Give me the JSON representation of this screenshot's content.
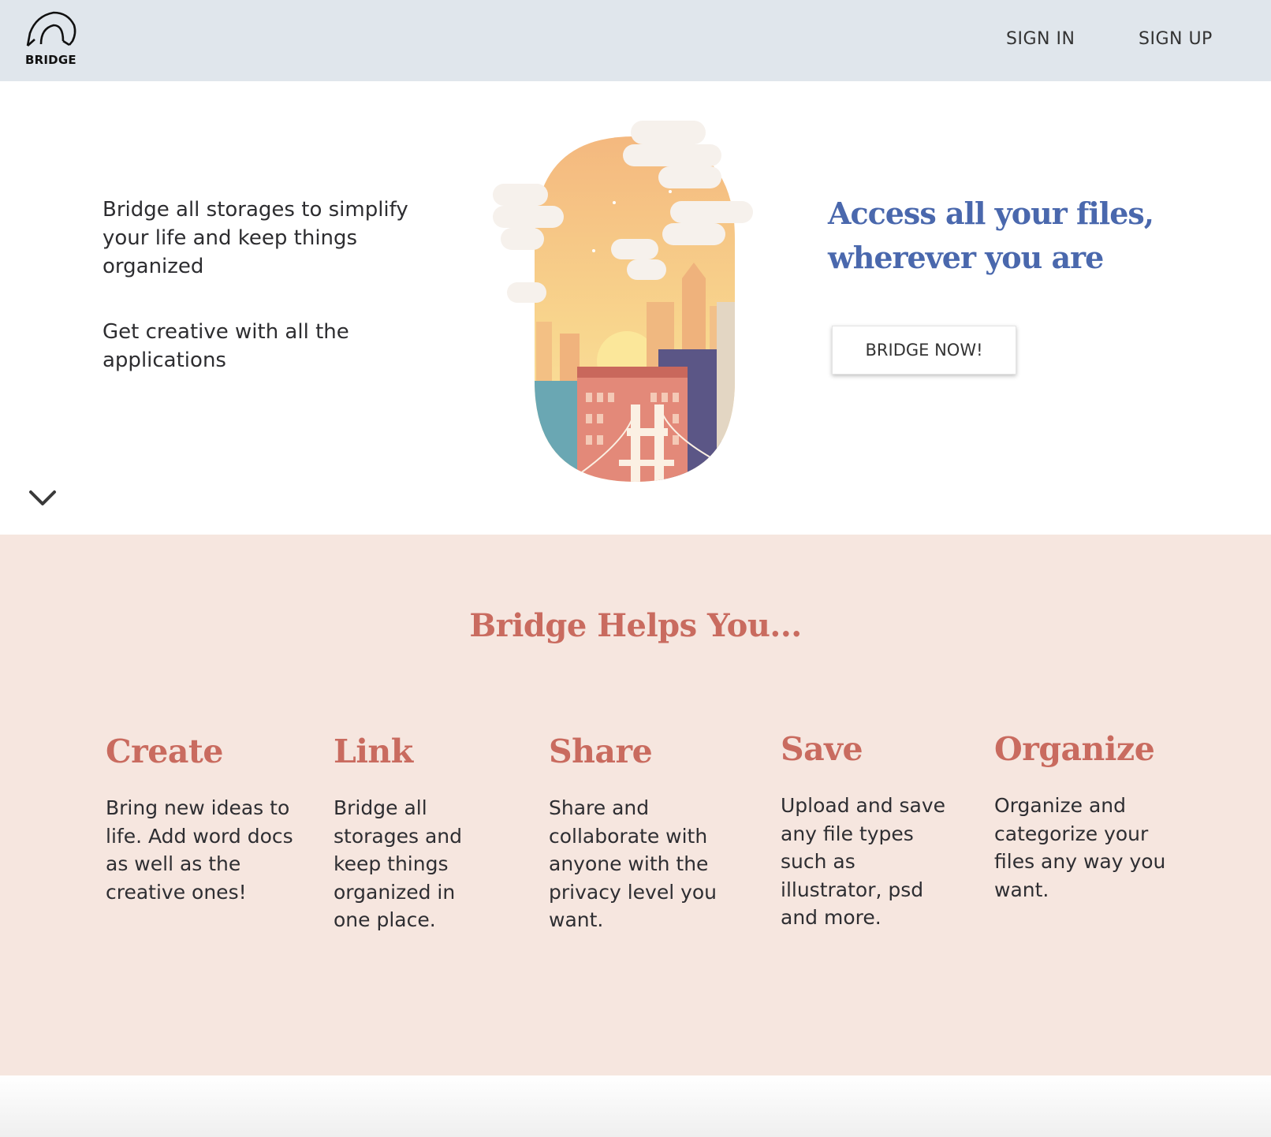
{
  "header": {
    "logo_text": "BRIDGE",
    "nav": {
      "sign_in": "SIGN IN",
      "sign_up": "SIGN UP"
    }
  },
  "hero": {
    "left_text_1": "Bridge all storages to simplify your life and keep things organized",
    "left_text_2": "Get creative with all the applications",
    "headline": "Access all your files, wherever you are",
    "cta_label": "BRIDGE NOW!",
    "scroll_icon": "chevron-down-icon"
  },
  "features": {
    "title": "Bridge Helps You...",
    "items": [
      {
        "title": "Create",
        "desc": "Bring new ideas to life. Add word docs as well as the creative ones!"
      },
      {
        "title": "Link",
        "desc": "Bridge all storages and keep things organized in one place."
      },
      {
        "title": "Share",
        "desc": "Share and collaborate with anyone with the privacy level you want."
      },
      {
        "title": "Save",
        "desc": "Upload and save any file types such as illustrator, psd and more."
      },
      {
        "title": "Organize",
        "desc": "Organize and categorize your files any way you want."
      }
    ]
  },
  "colors": {
    "header_bg": "#e0e6ec",
    "headline_blue": "#4a68ad",
    "accent_terracotta": "#c96b5f",
    "features_bg": "#f6e6df"
  }
}
